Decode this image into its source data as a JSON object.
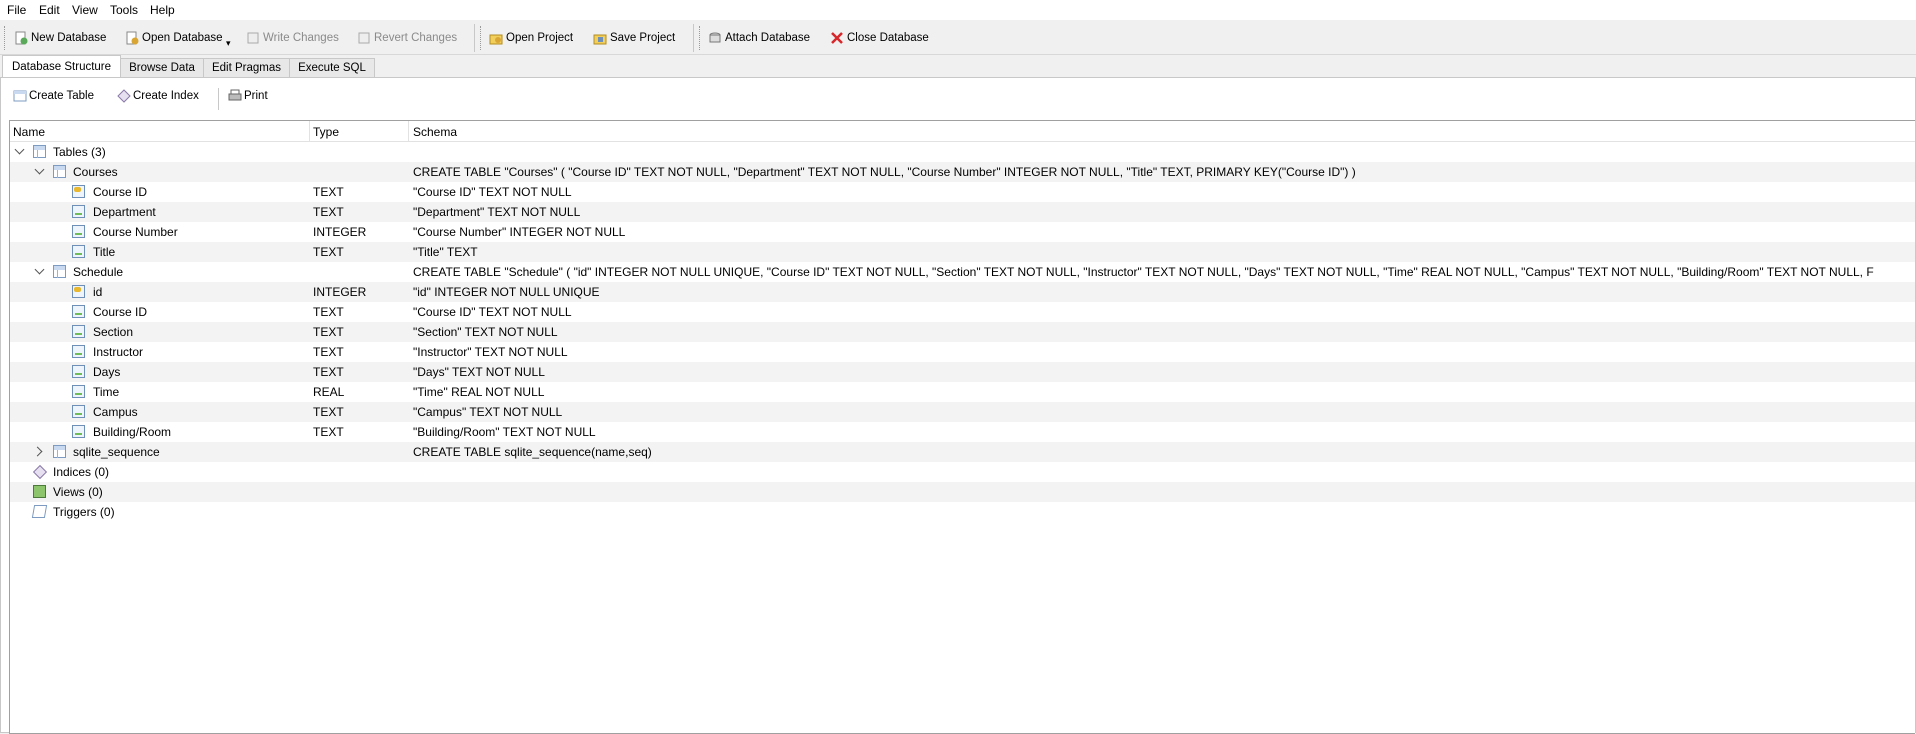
{
  "menu": [
    "File",
    "Edit",
    "View",
    "Tools",
    "Help"
  ],
  "toolbar": {
    "new_db": "New Database",
    "open_db": "Open Database",
    "write": "Write Changes",
    "revert": "Revert Changes",
    "open_project": "Open Project",
    "save_project": "Save Project",
    "attach": "Attach Database",
    "close": "Close Database"
  },
  "tabs": [
    "Database Structure",
    "Browse Data",
    "Edit Pragmas",
    "Execute SQL"
  ],
  "subtoolbar": {
    "create_table": "Create Table",
    "create_index": "Create Index",
    "print": "Print"
  },
  "columns": {
    "name": "Name",
    "type": "Type",
    "schema": "Schema"
  },
  "tree": [
    {
      "name": "Tables (3)",
      "type": "",
      "schema": ""
    },
    {
      "name": "Courses",
      "type": "",
      "schema": "CREATE TABLE \"Courses\" ( \"Course ID\" TEXT NOT NULL, \"Department\" TEXT NOT NULL, \"Course Number\" INTEGER NOT NULL, \"Title\" TEXT, PRIMARY KEY(\"Course ID\") )"
    },
    {
      "name": "Course ID",
      "type": "TEXT",
      "schema": "\"Course ID\" TEXT NOT NULL"
    },
    {
      "name": "Department",
      "type": "TEXT",
      "schema": "\"Department\" TEXT NOT NULL"
    },
    {
      "name": "Course Number",
      "type": "INTEGER",
      "schema": "\"Course Number\" INTEGER NOT NULL"
    },
    {
      "name": "Title",
      "type": "TEXT",
      "schema": "\"Title\" TEXT"
    },
    {
      "name": "Schedule",
      "type": "",
      "schema": "CREATE TABLE \"Schedule\" ( \"id\" INTEGER NOT NULL UNIQUE, \"Course ID\" TEXT NOT NULL, \"Section\" TEXT NOT NULL, \"Instructor\" TEXT NOT NULL, \"Days\" TEXT NOT NULL, \"Time\" REAL NOT NULL, \"Campus\" TEXT NOT NULL, \"Building/Room\" TEXT NOT NULL, F"
    },
    {
      "name": "id",
      "type": "INTEGER",
      "schema": "\"id\" INTEGER NOT NULL UNIQUE"
    },
    {
      "name": "Course ID",
      "type": "TEXT",
      "schema": "\"Course ID\" TEXT NOT NULL"
    },
    {
      "name": "Section",
      "type": "TEXT",
      "schema": "\"Section\" TEXT NOT NULL"
    },
    {
      "name": "Instructor",
      "type": "TEXT",
      "schema": "\"Instructor\" TEXT NOT NULL"
    },
    {
      "name": "Days",
      "type": "TEXT",
      "schema": "\"Days\" TEXT NOT NULL"
    },
    {
      "name": "Time",
      "type": "REAL",
      "schema": "\"Time\" REAL NOT NULL"
    },
    {
      "name": "Campus",
      "type": "TEXT",
      "schema": "\"Campus\" TEXT NOT NULL"
    },
    {
      "name": "Building/Room",
      "type": "TEXT",
      "schema": "\"Building/Room\" TEXT NOT NULL"
    },
    {
      "name": "sqlite_sequence",
      "type": "",
      "schema": "CREATE TABLE sqlite_sequence(name,seq)"
    },
    {
      "name": "Indices (0)",
      "type": "",
      "schema": ""
    },
    {
      "name": "Views (0)",
      "type": "",
      "schema": ""
    },
    {
      "name": "Triggers (0)",
      "type": "",
      "schema": ""
    }
  ]
}
